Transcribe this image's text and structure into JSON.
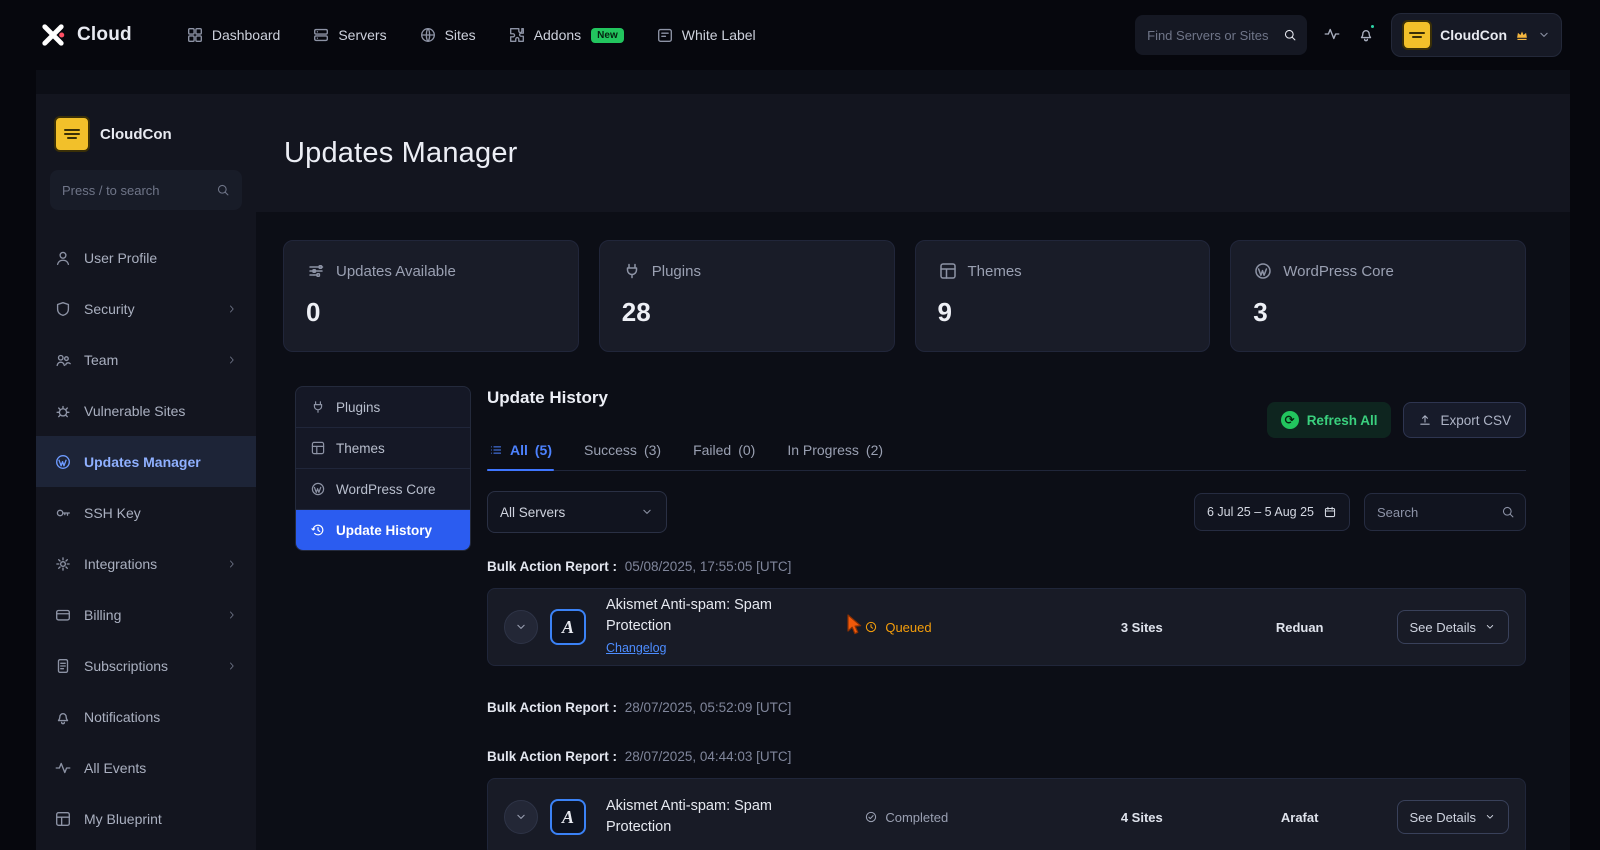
{
  "topnav": {
    "brand": "Cloud",
    "search_placeholder": "Find Servers or Sites",
    "items": [
      {
        "label": "Dashboard"
      },
      {
        "label": "Servers"
      },
      {
        "label": "Sites"
      },
      {
        "label": "Addons",
        "badge": "New"
      },
      {
        "label": "White Label"
      }
    ],
    "user_name": "CloudCon"
  },
  "sidebar": {
    "org_name": "CloudCon",
    "search_placeholder": "Press / to search",
    "items": [
      {
        "label": "User Profile"
      },
      {
        "label": "Security"
      },
      {
        "label": "Team"
      },
      {
        "label": "Vulnerable Sites"
      },
      {
        "label": "Updates Manager"
      },
      {
        "label": "SSH Key"
      },
      {
        "label": "Integrations"
      },
      {
        "label": "Billing"
      },
      {
        "label": "Subscriptions"
      },
      {
        "label": "Notifications"
      },
      {
        "label": "All Events"
      },
      {
        "label": "My Blueprint"
      }
    ]
  },
  "page": {
    "title": "Updates Manager"
  },
  "stats": [
    {
      "label": "Updates Available",
      "value": "0"
    },
    {
      "label": "Plugins",
      "value": "28"
    },
    {
      "label": "Themes",
      "value": "9"
    },
    {
      "label": "WordPress Core",
      "value": "3"
    }
  ],
  "subnav": {
    "items": [
      {
        "label": "Plugins"
      },
      {
        "label": "Themes"
      },
      {
        "label": "WordPress Core"
      },
      {
        "label": "Update History"
      }
    ]
  },
  "history": {
    "title": "Update History",
    "tabs": [
      {
        "label": "All",
        "count": "(5)"
      },
      {
        "label": "Success",
        "count": "(3)"
      },
      {
        "label": "Failed",
        "count": "(0)"
      },
      {
        "label": "In Progress",
        "count": "(2)"
      }
    ],
    "refresh_label": "Refresh All",
    "export_label": "Export CSV",
    "server_filter_value": "All Servers",
    "date_range": "6 Jul 25 – 5 Aug 25",
    "search_placeholder": "Search",
    "groups": [
      {
        "label": "Bulk Action Report :",
        "timestamp": "05/08/2025, 17:55:05 [UTC]"
      },
      {
        "label": "Bulk Action Report :",
        "timestamp": "28/07/2025, 05:52:09 [UTC]"
      },
      {
        "label": "Bulk Action Report :",
        "timestamp": "28/07/2025, 04:44:03 [UTC]"
      }
    ],
    "rows": [
      {
        "plugin_name": "Akismet Anti-spam: Spam Protection",
        "plugin_initial": "A",
        "changelog_label": "Changelog",
        "status": "Queued",
        "sites": "3 Sites",
        "user": "Reduan",
        "details_label": "See Details"
      },
      {
        "plugin_name": "Akismet Anti-spam: Spam Protection",
        "plugin_initial": "A",
        "status": "Completed",
        "sites": "4 Sites",
        "user": "Arafat",
        "details_label": "See Details"
      }
    ]
  },
  "colors": {
    "accent_blue": "#2b5cf0",
    "link_blue": "#4d8dff",
    "success_green": "#22c55e",
    "queued_orange": "#f59e0b"
  }
}
